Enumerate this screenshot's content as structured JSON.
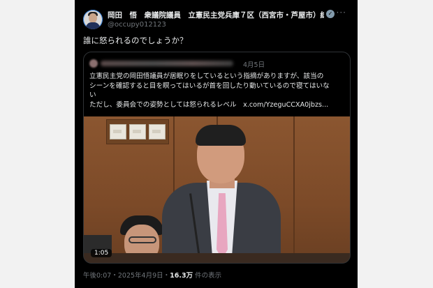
{
  "header": {
    "display_name": "岡田　悟　衆議院議員　立憲民主党兵庫７区（西宮市・芦屋市）総...",
    "handle": "@occupy012123",
    "verified_icon": "verified-badge-icon",
    "more_icon": "more-options-icon"
  },
  "tweet": {
    "text": "誰に怒られるのでしょうか？"
  },
  "quote": {
    "date": "4月5日",
    "lines": [
      "立憲民主党の岡田悟議員が居眠りをしているという指摘がありますが、該当の",
      "シーンを確認すると目を瞑ってはいるが首を回したり動いているので寝てはいな",
      "い",
      "ただし、委員会での姿勢としては怒られるレベル　x.com/YzeguCCXA0jbzs..."
    ],
    "video_duration": "1:05"
  },
  "meta": {
    "time": "午後0:07",
    "separator": "・",
    "date": "2025年4月9日",
    "views_count": "16.3万",
    "views_label": " 件の表示"
  },
  "colors": {
    "background": "#000000",
    "text": "#e7e9ea",
    "secondary_text": "#71767b",
    "border": "#2f3336"
  }
}
